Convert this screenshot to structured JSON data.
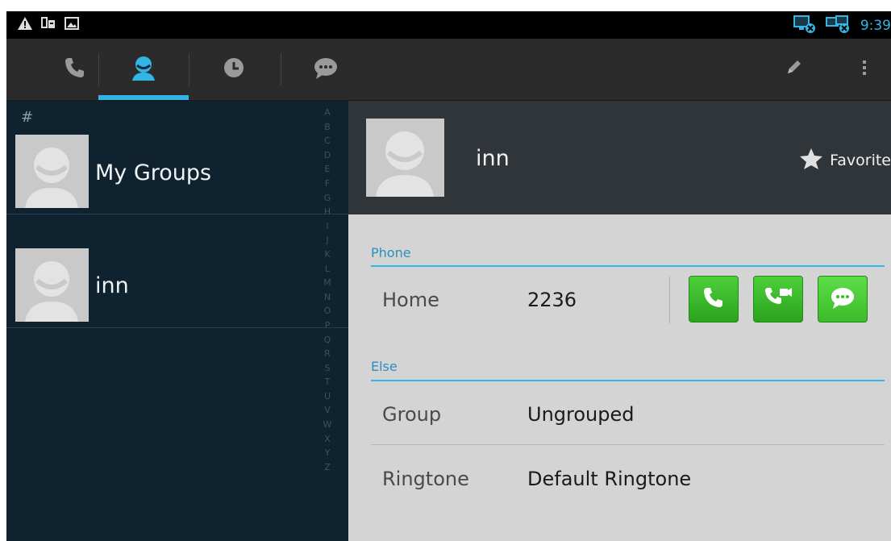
{
  "status_bar": {
    "time": "9:39",
    "left_icons": [
      "warning-icon",
      "usb-icon",
      "picture-icon"
    ],
    "right_icons": [
      "network-disconnected-icon",
      "network-disconnected-icon"
    ]
  },
  "action_bar": {
    "tabs": [
      {
        "icon": "phone-icon",
        "selected": false
      },
      {
        "icon": "contacts-icon",
        "selected": true
      },
      {
        "icon": "clock-icon",
        "selected": false
      },
      {
        "icon": "message-icon",
        "selected": false
      }
    ],
    "actions": [
      "edit-icon",
      "overflow-menu-icon"
    ],
    "accent": "#33b5e5"
  },
  "contact_list": {
    "section_header": "#",
    "items": [
      {
        "name": "My Groups"
      },
      {
        "name": "inn"
      }
    ],
    "alphabet": [
      "A",
      "B",
      "C",
      "D",
      "E",
      "F",
      "G",
      "H",
      "I",
      "J",
      "K",
      "L",
      "M",
      "N",
      "O",
      "P",
      "Q",
      "R",
      "S",
      "T",
      "U",
      "V",
      "W",
      "X",
      "Y",
      "Z"
    ]
  },
  "detail": {
    "name": "inn",
    "favorite_label": "Favorite",
    "phone_section": "Phone",
    "phone": {
      "label": "Home",
      "value": "2236"
    },
    "else_section": "Else",
    "group": {
      "label": "Group",
      "value": "Ungrouped"
    },
    "ringtone": {
      "label": "Ringtone",
      "value": "Default Ringtone"
    },
    "button_color": "#3cbc2a"
  }
}
